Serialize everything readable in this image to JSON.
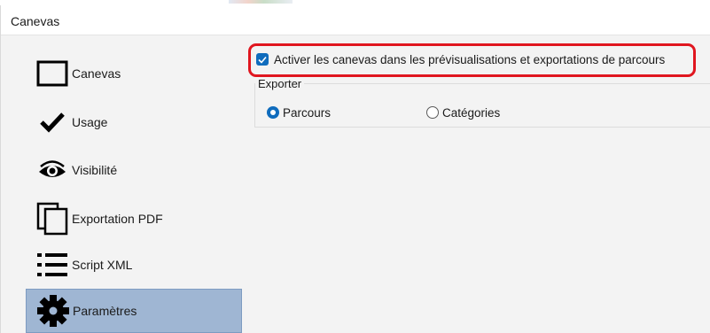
{
  "window": {
    "title": "Canevas"
  },
  "sidebar": {
    "items": [
      {
        "label": "Canevas",
        "icon": "rectangle-icon",
        "selected": false
      },
      {
        "label": "Usage",
        "icon": "checkmark-icon",
        "selected": false
      },
      {
        "label": "Visibilité",
        "icon": "eye-icon",
        "selected": false
      },
      {
        "label": "Exportation PDF",
        "icon": "copy-pages-icon",
        "selected": false
      },
      {
        "label": "Script XML",
        "icon": "list-icon",
        "selected": false
      },
      {
        "label": "Paramètres",
        "icon": "gear-icon",
        "selected": true
      }
    ]
  },
  "settings": {
    "enable_checkbox": {
      "label": "Activer les canevas dans les prévisualisations et exportations de parcours",
      "checked": true
    },
    "export_group": {
      "legend": "Exporter",
      "options": [
        {
          "label": "Parcours",
          "selected": true
        },
        {
          "label": "Catégories",
          "selected": false
        }
      ]
    }
  },
  "colors": {
    "accent": "#0f6cbd",
    "selection": "#9fb6d3",
    "annotation": "#e0161f",
    "background": "#f3f3f3"
  }
}
